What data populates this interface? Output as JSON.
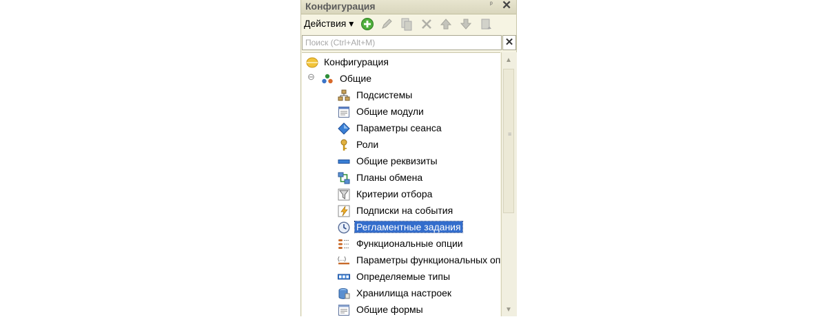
{
  "window": {
    "title": "Конфигурация",
    "pin_glyph": "ᵖ",
    "close_glyph": "✕"
  },
  "toolbar": {
    "actions_label": "Действия ▾",
    "buttons": [
      "add-icon",
      "edit-icon",
      "copy-icon",
      "delete-icon",
      "move-up-icon",
      "move-down-icon",
      "sort-icon"
    ]
  },
  "search": {
    "placeholder": "Поиск (Ctrl+Alt+M)",
    "value": "",
    "clear_glyph": "✕"
  },
  "tree": {
    "root": {
      "label": "Конфигурация",
      "icon": "configuration-icon"
    },
    "common": {
      "label": "Общие",
      "icon": "common-icon",
      "expander": "⊖",
      "expanded": true
    },
    "items": [
      {
        "label": "Подсистемы",
        "icon": "subsystems-icon"
      },
      {
        "label": "Общие модули",
        "icon": "common-modules-icon"
      },
      {
        "label": "Параметры сеанса",
        "icon": "session-parameters-icon"
      },
      {
        "label": "Роли",
        "icon": "roles-icon"
      },
      {
        "label": "Общие реквизиты",
        "icon": "common-attributes-icon"
      },
      {
        "label": "Планы обмена",
        "icon": "exchange-plans-icon"
      },
      {
        "label": "Критерии отбора",
        "icon": "filter-criteria-icon"
      },
      {
        "label": "Подписки на события",
        "icon": "event-subscriptions-icon"
      },
      {
        "label": "Регламентные задания",
        "icon": "scheduled-jobs-icon",
        "selected": true
      },
      {
        "label": "Функциональные опции",
        "icon": "functional-options-icon"
      },
      {
        "label": "Параметры функциональных опц",
        "icon": "functional-options-parameters-icon"
      },
      {
        "label": "Определяемые типы",
        "icon": "defined-types-icon"
      },
      {
        "label": "Хранилища настроек",
        "icon": "settings-storages-icon"
      },
      {
        "label": "Общие формы",
        "icon": "common-forms-icon"
      }
    ]
  },
  "scrollbar": {
    "up_glyph": "▲",
    "down_glyph": "▼",
    "grip_glyph": "≡"
  },
  "colors": {
    "panel_bg": "#f6f4e3",
    "selection": "#336dcc",
    "title_text": "#5a5a5a"
  }
}
